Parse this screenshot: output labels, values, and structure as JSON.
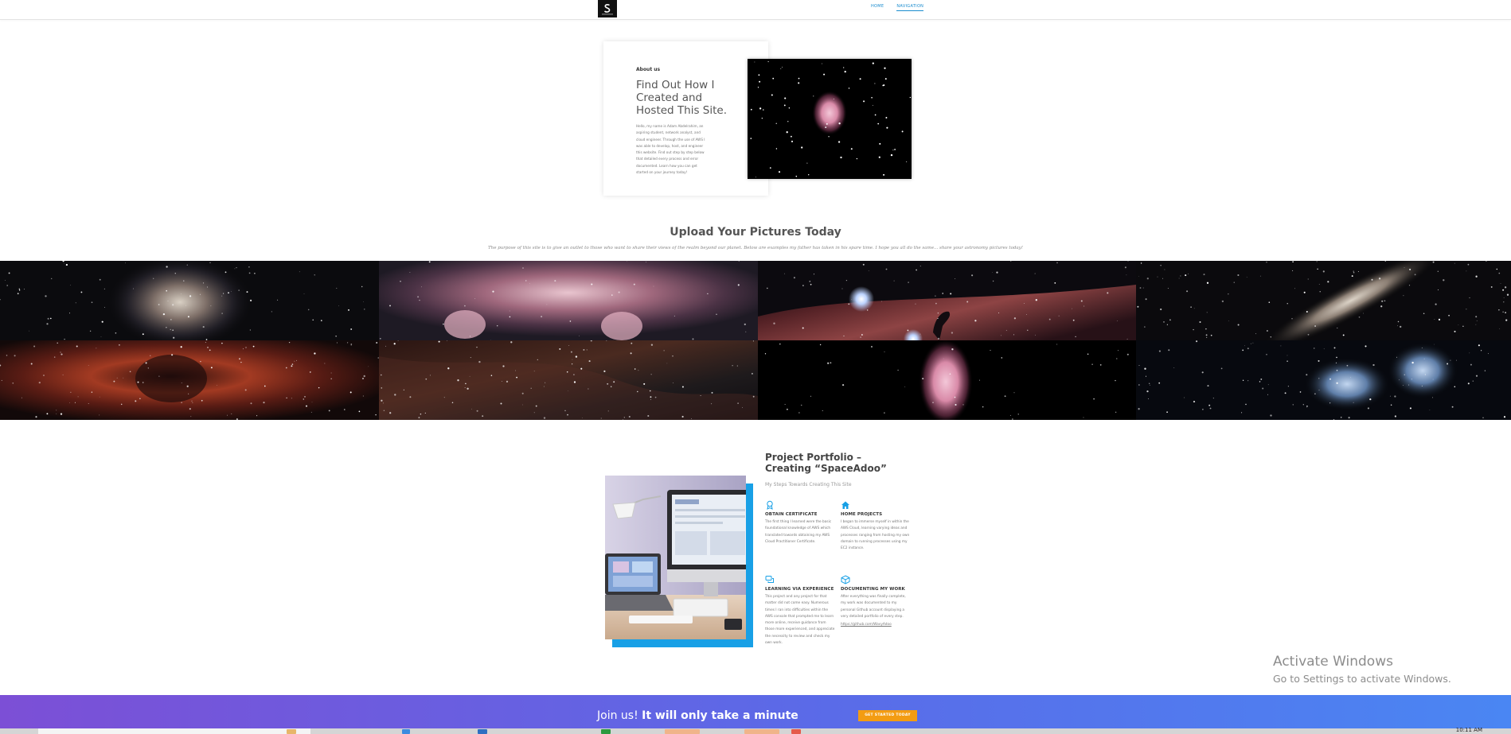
{
  "header": {
    "logo_icon": "spaceadoo-logo-icon",
    "nav": [
      {
        "label": "HOME"
      },
      {
        "label": "NAVIGATION",
        "active": true
      }
    ]
  },
  "about": {
    "label": "About us",
    "title": "Find Out How I Created and Hosted This Site.",
    "text": "Hello, my name is Adam Abdelrahim, an aspiring student, network analyst, and cloud engineer. Through the use of AWS I was able to develop, host, and engineer this website. Find out step by step below that detailed every process and error documented. Learn how you can get started on your journey today!"
  },
  "upload": {
    "title": "Upload Your Pictures Today",
    "subtitle": "The purpose of this site is to give an outlet to those who want to share their views of the realm beyond our planet. Below are examples my father has taken in his spare time. I hope you all do the same... share your astronomy pictures today!"
  },
  "portfolio": {
    "title": "Project Portfolio – Creating “SpaceAdoo”",
    "subtitle": "My Steps Towards Creating This Site",
    "features": [
      {
        "icon": "award-icon",
        "title": "OBTAIN CERTIFICATE",
        "text": "The first thing I learned were the basic foundational knowledge of AWS which translated towards obtaining my AWS Cloud Practitioner Certificate."
      },
      {
        "icon": "home-icon",
        "title": "HOME PROJECTS",
        "text": "I began to immerse myself in within the AWS Cloud, learning varying ideas and processes ranging from hosting my own domain to running processes using my EC2 instance."
      },
      {
        "icon": "chat-icon",
        "title": "LEARNING VIA EXPERIENCE",
        "text": "This project and any project for that matter did not come easy. Numerous times I ran into difficulties within the AWS console that prompted me to learn more online, receive guidance from those more experienced, and appreciate the necessity to review and check my own work."
      },
      {
        "icon": "cube-icon",
        "title": "DOCUMENTING MY WORK",
        "text": "After everything was finally complete, my work was documented to my personal Github account displaying a very detailed portfolio of every step.",
        "link": "https://github.com/WavyAdoo"
      }
    ]
  },
  "watermark": {
    "line1": "Activate Windows",
    "line2": "Go to Settings to activate Windows."
  },
  "cta": {
    "lead": "Join us! ",
    "bold": "It will only take a minute",
    "button": "GET STARTED TODAY"
  },
  "taskbar": {
    "clock": "10:11 AM"
  },
  "colors": {
    "accent": "#18a0e6",
    "nav_link": "#1a8ccf",
    "cta_button": "#f39c12",
    "cta_gradient_start": "#7c4fd6",
    "cta_gradient_end": "#4a86f3"
  }
}
